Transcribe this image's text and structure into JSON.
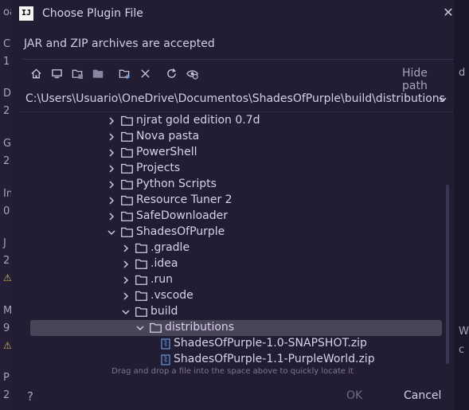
{
  "window": {
    "title": "Choose Plugin File",
    "subtitle": "JAR and ZIP archives are accepted",
    "app_icon_text": "IJ"
  },
  "toolbar": {
    "icons": [
      "home-icon",
      "desktop-icon",
      "project-icon",
      "module-icon",
      "new-folder-icon",
      "delete-icon",
      "refresh-icon",
      "show-hidden-icon"
    ],
    "hide_path_label": "Hide path"
  },
  "path": {
    "value": "C:\\Users\\Usuario\\OneDrive\\Documentos\\ShadesOfPurple\\build\\distributions"
  },
  "tree": {
    "items": [
      {
        "label": "njrat gold edition 0.7d",
        "type": "folder",
        "expanded": false,
        "level": 0
      },
      {
        "label": "Nova pasta",
        "type": "folder",
        "expanded": false,
        "level": 0
      },
      {
        "label": "PowerShell",
        "type": "folder",
        "expanded": false,
        "level": 0
      },
      {
        "label": "Projects",
        "type": "folder",
        "expanded": false,
        "level": 0
      },
      {
        "label": "Python Scripts",
        "type": "folder",
        "expanded": false,
        "level": 0
      },
      {
        "label": "Resource Tuner 2",
        "type": "folder",
        "expanded": false,
        "level": 0
      },
      {
        "label": "SafeDownloader",
        "type": "folder",
        "expanded": false,
        "level": 0
      },
      {
        "label": "ShadesOfPurple",
        "type": "folder",
        "expanded": true,
        "level": 0
      },
      {
        "label": ".gradle",
        "type": "folder",
        "expanded": false,
        "level": 1
      },
      {
        "label": ".idea",
        "type": "folder",
        "expanded": false,
        "level": 1
      },
      {
        "label": ".run",
        "type": "folder",
        "expanded": false,
        "level": 1
      },
      {
        "label": ".vscode",
        "type": "folder",
        "expanded": false,
        "level": 1
      },
      {
        "label": "build",
        "type": "folder",
        "expanded": true,
        "level": 1
      },
      {
        "label": "distributions",
        "type": "folder",
        "expanded": true,
        "level": 2,
        "selected": true
      },
      {
        "label": "ShadesOfPurple-1.0-SNAPSHOT.zip",
        "type": "zip",
        "level": 3
      },
      {
        "label": "ShadesOfPurple-1.1-PurpleWorld.zip",
        "type": "zip",
        "level": 3
      }
    ]
  },
  "hint": "Drag and drop a file into the space above to quickly locate it",
  "buttons": {
    "help": "?",
    "ok": "OK",
    "cancel": "Cancel"
  },
  "background_left": [
    "oad",
    "C",
    "1",
    "D",
    "2",
    "G",
    "2",
    "In",
    "0",
    "J",
    "2",
    "⚠",
    "M",
    "9",
    "⚠",
    "P",
    "2"
  ],
  "background_right": [
    "d",
    "W",
    "c"
  ],
  "colors": {
    "dialog_bg": "#221d33",
    "selection": "#4a4458",
    "text": "#d8d2ea",
    "folder": "#d6d0e6",
    "zip_icon": "#5b8fd8"
  }
}
